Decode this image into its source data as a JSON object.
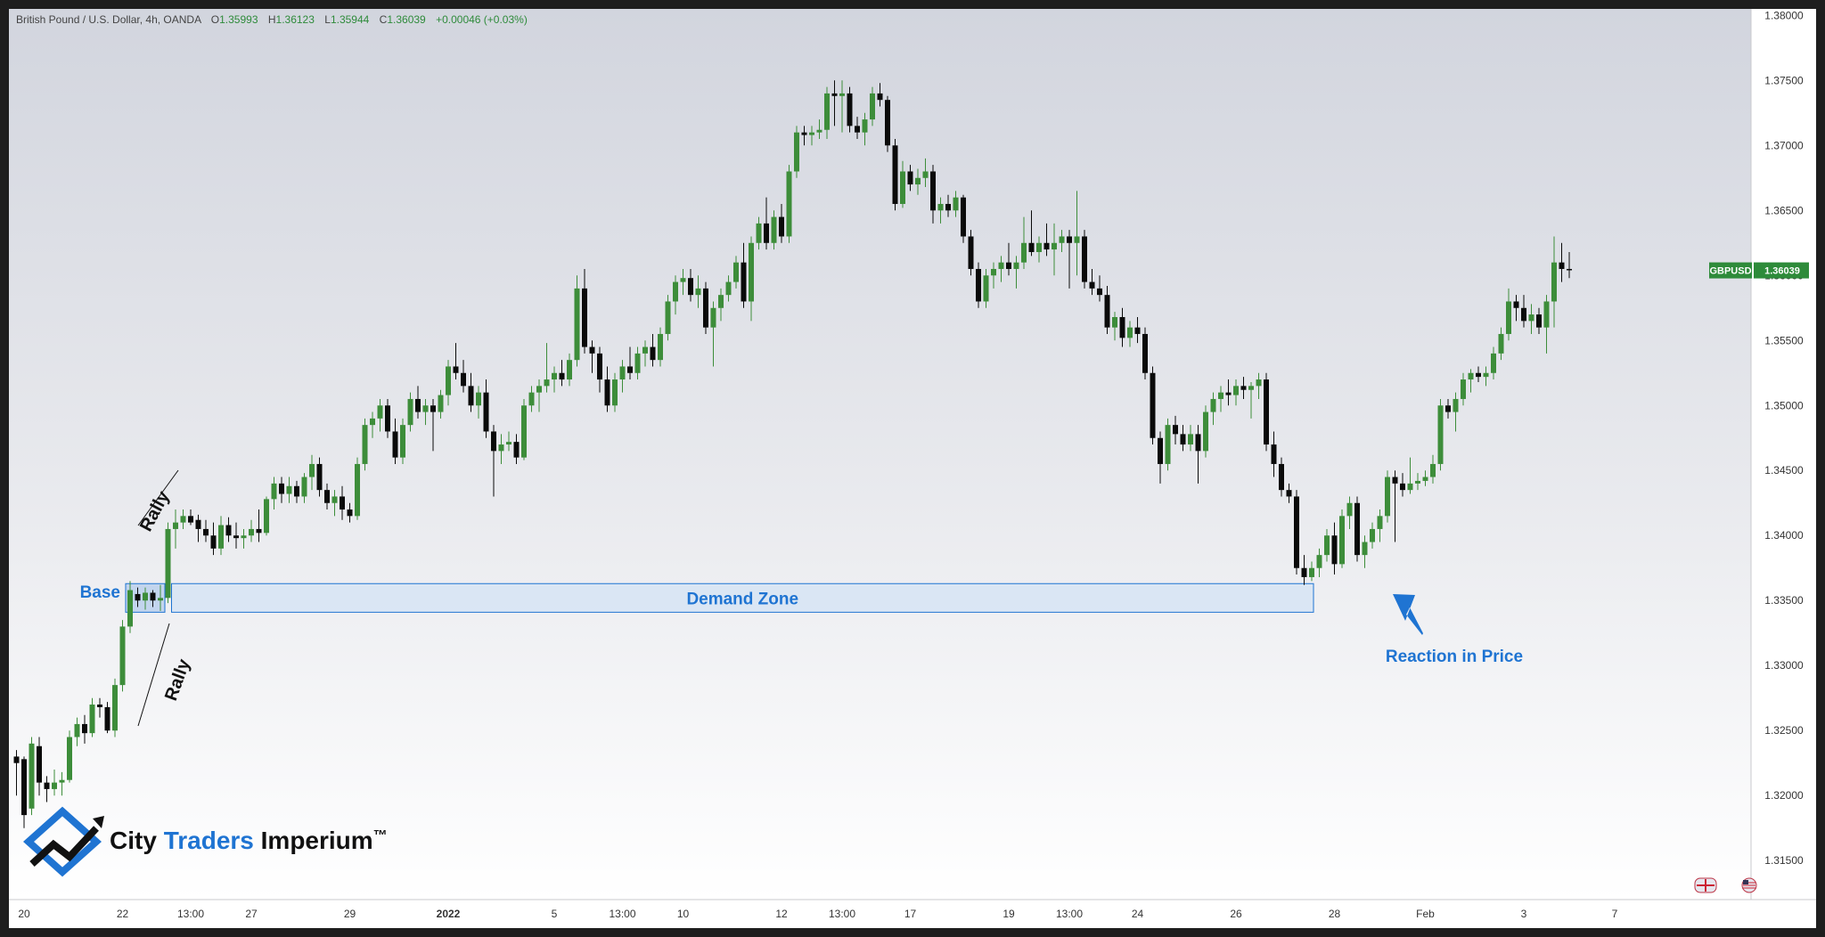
{
  "header": {
    "symbol_desc": "British Pound / U.S. Dollar, 4h, OANDA",
    "o_label": "O",
    "o_value": "1.35993",
    "h_label": "H",
    "h_value": "1.36123",
    "l_label": "L",
    "l_value": "1.35944",
    "c_label": "C",
    "c_value": "1.36039",
    "change": "+0.00046 (+0.03%)"
  },
  "price_tag": {
    "symbol": "GBPUSD",
    "value": "1.36039",
    "price": 1.36039
  },
  "annotations": {
    "base": "Base",
    "rally_up": "Rally",
    "rally_down": "Rally",
    "demand_zone": "Demand Zone",
    "reaction": "Reaction in Price"
  },
  "logo": {
    "word1": "City ",
    "word2": "Traders",
    "word3": " Imperium",
    "tm": "™"
  },
  "colors": {
    "up": "#3d8d3a",
    "down": "#0a0a0a",
    "accent": "#1f74d2",
    "zone_fill": "#d6e4f5",
    "tag_bg": "#2e8b3a"
  },
  "chart_data": {
    "type": "candlestick",
    "title": "British Pound / U.S. Dollar, 4h, OANDA",
    "ylim": [
      1.312,
      1.3805
    ],
    "y_ticks": [
      1.315,
      1.32,
      1.325,
      1.33,
      1.335,
      1.34,
      1.345,
      1.35,
      1.355,
      1.36,
      1.365,
      1.37,
      1.375,
      1.38
    ],
    "y_tick_labels": [
      "1.31500",
      "1.32000",
      "1.32500",
      "1.33000",
      "1.33500",
      "1.34000",
      "1.34500",
      "1.35000",
      "1.35500",
      "1.36000",
      "1.36500",
      "1.37000",
      "1.37500",
      "1.38000"
    ],
    "x_labels": [
      {
        "label": "20",
        "bar": 1,
        "bold": false
      },
      {
        "label": "22",
        "bar": 14,
        "bold": false
      },
      {
        "label": "13:00",
        "bar": 23,
        "bold": false
      },
      {
        "label": "27",
        "bar": 31,
        "bold": false
      },
      {
        "label": "29",
        "bar": 44,
        "bold": false
      },
      {
        "label": "2022",
        "bar": 57,
        "bold": true
      },
      {
        "label": "5",
        "bar": 71,
        "bold": false
      },
      {
        "label": "13:00",
        "bar": 80,
        "bold": false
      },
      {
        "label": "10",
        "bar": 88,
        "bold": false
      },
      {
        "label": "12",
        "bar": 101,
        "bold": false
      },
      {
        "label": "13:00",
        "bar": 109,
        "bold": false
      },
      {
        "label": "17",
        "bar": 118,
        "bold": false
      },
      {
        "label": "19",
        "bar": 131,
        "bold": false
      },
      {
        "label": "13:00",
        "bar": 139,
        "bold": false
      },
      {
        "label": "24",
        "bar": 148,
        "bold": false
      },
      {
        "label": "26",
        "bar": 161,
        "bold": false
      },
      {
        "label": "28",
        "bar": 174,
        "bold": false
      },
      {
        "label": "Feb",
        "bar": 186,
        "bold": false
      },
      {
        "label": "3",
        "bar": 199,
        "bold": false
      },
      {
        "label": "7",
        "bar": 211,
        "bold": false
      }
    ],
    "demand_zone": {
      "from_bar": 14,
      "to_bar": 171,
      "low": 1.3341,
      "high": 1.3363
    },
    "ohlc": [
      [
        1.323,
        1.3235,
        1.32,
        1.3225
      ],
      [
        1.3228,
        1.323,
        1.3175,
        1.3185
      ],
      [
        1.319,
        1.3245,
        1.3185,
        1.324
      ],
      [
        1.3238,
        1.3245,
        1.32,
        1.321
      ],
      [
        1.321,
        1.3215,
        1.3195,
        1.3205
      ],
      [
        1.3205,
        1.322,
        1.32,
        1.321
      ],
      [
        1.321,
        1.3218,
        1.32,
        1.3212
      ],
      [
        1.3212,
        1.325,
        1.321,
        1.3245
      ],
      [
        1.3245,
        1.326,
        1.3238,
        1.3255
      ],
      [
        1.3255,
        1.3262,
        1.324,
        1.3248
      ],
      [
        1.3248,
        1.3275,
        1.3245,
        1.327
      ],
      [
        1.327,
        1.3275,
        1.326,
        1.3268
      ],
      [
        1.3268,
        1.3272,
        1.3248,
        1.325
      ],
      [
        1.325,
        1.329,
        1.3245,
        1.3285
      ],
      [
        1.3285,
        1.3335,
        1.328,
        1.333
      ],
      [
        1.333,
        1.3365,
        1.3325,
        1.3358
      ],
      [
        1.3355,
        1.336,
        1.3345,
        1.335
      ],
      [
        1.335,
        1.336,
        1.3343,
        1.3356
      ],
      [
        1.3356,
        1.3358,
        1.3345,
        1.335
      ],
      [
        1.335,
        1.3362,
        1.3342,
        1.3352
      ],
      [
        1.3352,
        1.341,
        1.3348,
        1.3405
      ],
      [
        1.3405,
        1.342,
        1.339,
        1.341
      ],
      [
        1.341,
        1.342,
        1.3405,
        1.3415
      ],
      [
        1.3415,
        1.342,
        1.3408,
        1.341
      ],
      [
        1.3412,
        1.3416,
        1.3395,
        1.3405
      ],
      [
        1.3405,
        1.3412,
        1.3395,
        1.34
      ],
      [
        1.34,
        1.341,
        1.3385,
        1.339
      ],
      [
        1.339,
        1.3415,
        1.3385,
        1.3408
      ],
      [
        1.3408,
        1.3414,
        1.3395,
        1.34
      ],
      [
        1.34,
        1.341,
        1.339,
        1.3398
      ],
      [
        1.3398,
        1.3405,
        1.339,
        1.34
      ],
      [
        1.34,
        1.3412,
        1.3395,
        1.3405
      ],
      [
        1.3405,
        1.342,
        1.3395,
        1.3402
      ],
      [
        1.3402,
        1.343,
        1.34,
        1.3428
      ],
      [
        1.3428,
        1.3445,
        1.342,
        1.344
      ],
      [
        1.344,
        1.3445,
        1.3425,
        1.3432
      ],
      [
        1.3432,
        1.3445,
        1.3425,
        1.3438
      ],
      [
        1.3438,
        1.3442,
        1.3425,
        1.343
      ],
      [
        1.343,
        1.3448,
        1.3425,
        1.3445
      ],
      [
        1.3445,
        1.3462,
        1.3435,
        1.3455
      ],
      [
        1.3455,
        1.346,
        1.343,
        1.3435
      ],
      [
        1.3435,
        1.344,
        1.342,
        1.3425
      ],
      [
        1.3425,
        1.3435,
        1.3415,
        1.343
      ],
      [
        1.343,
        1.3438,
        1.3412,
        1.342
      ],
      [
        1.342,
        1.3425,
        1.341,
        1.3415
      ],
      [
        1.3415,
        1.346,
        1.3412,
        1.3455
      ],
      [
        1.3455,
        1.349,
        1.345,
        1.3485
      ],
      [
        1.3485,
        1.3495,
        1.3475,
        1.349
      ],
      [
        1.349,
        1.3505,
        1.348,
        1.35
      ],
      [
        1.35,
        1.3505,
        1.3475,
        1.348
      ],
      [
        1.348,
        1.349,
        1.3455,
        1.346
      ],
      [
        1.346,
        1.349,
        1.3455,
        1.3485
      ],
      [
        1.3485,
        1.351,
        1.348,
        1.3505
      ],
      [
        1.3505,
        1.3515,
        1.349,
        1.3495
      ],
      [
        1.3495,
        1.3505,
        1.3485,
        1.35
      ],
      [
        1.35,
        1.3505,
        1.3465,
        1.3495
      ],
      [
        1.3495,
        1.3512,
        1.349,
        1.3508
      ],
      [
        1.3508,
        1.3535,
        1.35,
        1.353
      ],
      [
        1.353,
        1.3548,
        1.352,
        1.3525
      ],
      [
        1.3525,
        1.3535,
        1.351,
        1.3515
      ],
      [
        1.3515,
        1.3525,
        1.3495,
        1.35
      ],
      [
        1.35,
        1.3515,
        1.349,
        1.351
      ],
      [
        1.351,
        1.352,
        1.3475,
        1.348
      ],
      [
        1.348,
        1.3485,
        1.343,
        1.3465
      ],
      [
        1.3465,
        1.3478,
        1.3455,
        1.347
      ],
      [
        1.347,
        1.348,
        1.3465,
        1.3472
      ],
      [
        1.3472,
        1.3478,
        1.3455,
        1.346
      ],
      [
        1.346,
        1.3505,
        1.3458,
        1.35
      ],
      [
        1.35,
        1.3515,
        1.3495,
        1.351
      ],
      [
        1.351,
        1.352,
        1.3495,
        1.3515
      ],
      [
        1.3515,
        1.3548,
        1.351,
        1.352
      ],
      [
        1.352,
        1.353,
        1.351,
        1.3525
      ],
      [
        1.3525,
        1.3535,
        1.3515,
        1.352
      ],
      [
        1.352,
        1.354,
        1.3515,
        1.3535
      ],
      [
        1.3535,
        1.36,
        1.353,
        1.359
      ],
      [
        1.359,
        1.3605,
        1.354,
        1.3545
      ],
      [
        1.3545,
        1.355,
        1.3525,
        1.354
      ],
      [
        1.354,
        1.3545,
        1.351,
        1.352
      ],
      [
        1.352,
        1.353,
        1.3495,
        1.35
      ],
      [
        1.35,
        1.3525,
        1.3495,
        1.352
      ],
      [
        1.352,
        1.3535,
        1.351,
        1.353
      ],
      [
        1.353,
        1.3545,
        1.352,
        1.3525
      ],
      [
        1.3525,
        1.3545,
        1.352,
        1.354
      ],
      [
        1.354,
        1.355,
        1.353,
        1.3545
      ],
      [
        1.3545,
        1.3555,
        1.353,
        1.3535
      ],
      [
        1.3535,
        1.356,
        1.353,
        1.3555
      ],
      [
        1.3555,
        1.3585,
        1.355,
        1.358
      ],
      [
        1.358,
        1.36,
        1.357,
        1.3595
      ],
      [
        1.3595,
        1.3605,
        1.3585,
        1.3598
      ],
      [
        1.3598,
        1.3605,
        1.358,
        1.3585
      ],
      [
        1.3585,
        1.36,
        1.3575,
        1.359
      ],
      [
        1.359,
        1.3595,
        1.3555,
        1.356
      ],
      [
        1.356,
        1.358,
        1.353,
        1.3575
      ],
      [
        1.3575,
        1.359,
        1.3565,
        1.3585
      ],
      [
        1.3585,
        1.36,
        1.358,
        1.3595
      ],
      [
        1.3595,
        1.3615,
        1.359,
        1.361
      ],
      [
        1.361,
        1.3625,
        1.3575,
        1.358
      ],
      [
        1.358,
        1.363,
        1.3565,
        1.3625
      ],
      [
        1.3625,
        1.3645,
        1.362,
        1.364
      ],
      [
        1.364,
        1.366,
        1.362,
        1.3625
      ],
      [
        1.3625,
        1.365,
        1.362,
        1.3645
      ],
      [
        1.3645,
        1.3655,
        1.3625,
        1.363
      ],
      [
        1.363,
        1.3685,
        1.3625,
        1.368
      ],
      [
        1.368,
        1.3715,
        1.3675,
        1.371
      ],
      [
        1.371,
        1.3715,
        1.37,
        1.3708
      ],
      [
        1.3708,
        1.3715,
        1.37,
        1.371
      ],
      [
        1.371,
        1.372,
        1.3705,
        1.3712
      ],
      [
        1.3712,
        1.3745,
        1.3705,
        1.374
      ],
      [
        1.374,
        1.375,
        1.3715,
        1.3738
      ],
      [
        1.3738,
        1.375,
        1.371,
        1.374
      ],
      [
        1.374,
        1.3745,
        1.371,
        1.3715
      ],
      [
        1.3715,
        1.3722,
        1.3705,
        1.371
      ],
      [
        1.371,
        1.3725,
        1.37,
        1.372
      ],
      [
        1.372,
        1.3745,
        1.3715,
        1.374
      ],
      [
        1.374,
        1.3748,
        1.373,
        1.3735
      ],
      [
        1.3735,
        1.3738,
        1.3695,
        1.37
      ],
      [
        1.37,
        1.3705,
        1.365,
        1.3655
      ],
      [
        1.3655,
        1.3688,
        1.3652,
        1.368
      ],
      [
        1.368,
        1.3685,
        1.3665,
        1.367
      ],
      [
        1.367,
        1.3682,
        1.3662,
        1.3675
      ],
      [
        1.3675,
        1.369,
        1.3668,
        1.368
      ],
      [
        1.368,
        1.3685,
        1.364,
        1.365
      ],
      [
        1.365,
        1.366,
        1.364,
        1.3655
      ],
      [
        1.3655,
        1.3662,
        1.3645,
        1.365
      ],
      [
        1.365,
        1.3665,
        1.3645,
        1.366
      ],
      [
        1.366,
        1.3662,
        1.3625,
        1.363
      ],
      [
        1.363,
        1.3635,
        1.36,
        1.3605
      ],
      [
        1.3605,
        1.361,
        1.3575,
        1.358
      ],
      [
        1.358,
        1.3605,
        1.3575,
        1.36
      ],
      [
        1.36,
        1.361,
        1.359,
        1.3605
      ],
      [
        1.3605,
        1.3615,
        1.3595,
        1.361
      ],
      [
        1.361,
        1.3625,
        1.36,
        1.3605
      ],
      [
        1.3605,
        1.3615,
        1.359,
        1.361
      ],
      [
        1.361,
        1.3645,
        1.3605,
        1.3625
      ],
      [
        1.3625,
        1.365,
        1.3615,
        1.3618
      ],
      [
        1.3618,
        1.363,
        1.361,
        1.3625
      ],
      [
        1.3625,
        1.364,
        1.3615,
        1.362
      ],
      [
        1.362,
        1.364,
        1.36,
        1.3625
      ],
      [
        1.3625,
        1.3635,
        1.3618,
        1.363
      ],
      [
        1.363,
        1.3635,
        1.359,
        1.3625
      ],
      [
        1.3625,
        1.3665,
        1.36,
        1.363
      ],
      [
        1.363,
        1.3635,
        1.359,
        1.3595
      ],
      [
        1.3595,
        1.3605,
        1.3585,
        1.359
      ],
      [
        1.359,
        1.36,
        1.358,
        1.3585
      ],
      [
        1.3585,
        1.3592,
        1.3555,
        1.356
      ],
      [
        1.356,
        1.3572,
        1.355,
        1.3568
      ],
      [
        1.3568,
        1.3575,
        1.3545,
        1.3552
      ],
      [
        1.3552,
        1.3565,
        1.3545,
        1.356
      ],
      [
        1.356,
        1.3568,
        1.3548,
        1.3555
      ],
      [
        1.3555,
        1.356,
        1.352,
        1.3525
      ],
      [
        1.3525,
        1.353,
        1.347,
        1.3475
      ],
      [
        1.3475,
        1.348,
        1.344,
        1.3455
      ],
      [
        1.3455,
        1.349,
        1.345,
        1.3485
      ],
      [
        1.3485,
        1.3492,
        1.347,
        1.3478
      ],
      [
        1.3478,
        1.3485,
        1.3465,
        1.347
      ],
      [
        1.347,
        1.3485,
        1.3465,
        1.3478
      ],
      [
        1.3478,
        1.3485,
        1.344,
        1.3465
      ],
      [
        1.3465,
        1.35,
        1.346,
        1.3495
      ],
      [
        1.3495,
        1.351,
        1.3485,
        1.3505
      ],
      [
        1.3505,
        1.3515,
        1.3495,
        1.351
      ],
      [
        1.351,
        1.352,
        1.35,
        1.3508
      ],
      [
        1.3508,
        1.352,
        1.35,
        1.3515
      ],
      [
        1.3515,
        1.3522,
        1.3505,
        1.3512
      ],
      [
        1.3512,
        1.3518,
        1.349,
        1.3515
      ],
      [
        1.3515,
        1.3525,
        1.3505,
        1.352
      ],
      [
        1.352,
        1.3525,
        1.3465,
        1.347
      ],
      [
        1.347,
        1.348,
        1.3445,
        1.3455
      ],
      [
        1.3455,
        1.346,
        1.343,
        1.3435
      ],
      [
        1.3435,
        1.344,
        1.3425,
        1.343
      ],
      [
        1.343,
        1.3435,
        1.337,
        1.3375
      ],
      [
        1.3375,
        1.3385,
        1.3362,
        1.3368
      ],
      [
        1.3368,
        1.338,
        1.3365,
        1.3375
      ],
      [
        1.3375,
        1.339,
        1.3368,
        1.3385
      ],
      [
        1.3385,
        1.3405,
        1.338,
        1.34
      ],
      [
        1.34,
        1.341,
        1.337,
        1.3378
      ],
      [
        1.3378,
        1.342,
        1.3375,
        1.3415
      ],
      [
        1.3415,
        1.343,
        1.3405,
        1.3425
      ],
      [
        1.3425,
        1.343,
        1.338,
        1.3385
      ],
      [
        1.3385,
        1.34,
        1.3375,
        1.3395
      ],
      [
        1.3395,
        1.341,
        1.339,
        1.3405
      ],
      [
        1.3405,
        1.342,
        1.3395,
        1.3415
      ],
      [
        1.3415,
        1.345,
        1.341,
        1.3445
      ],
      [
        1.3445,
        1.345,
        1.3395,
        1.344
      ],
      [
        1.344,
        1.3448,
        1.343,
        1.3435
      ],
      [
        1.3435,
        1.346,
        1.3432,
        1.344
      ],
      [
        1.344,
        1.3448,
        1.3435,
        1.3442
      ],
      [
        1.3442,
        1.345,
        1.3438,
        1.3445
      ],
      [
        1.3445,
        1.3462,
        1.344,
        1.3455
      ],
      [
        1.3455,
        1.3505,
        1.345,
        1.35
      ],
      [
        1.35,
        1.3505,
        1.349,
        1.3495
      ],
      [
        1.3495,
        1.351,
        1.348,
        1.3505
      ],
      [
        1.3505,
        1.3525,
        1.35,
        1.352
      ],
      [
        1.352,
        1.3528,
        1.351,
        1.3525
      ],
      [
        1.3525,
        1.353,
        1.3518,
        1.3522
      ],
      [
        1.3522,
        1.353,
        1.3515,
        1.3525
      ],
      [
        1.3525,
        1.3545,
        1.352,
        1.354
      ],
      [
        1.354,
        1.356,
        1.3535,
        1.3555
      ],
      [
        1.3555,
        1.359,
        1.355,
        1.358
      ],
      [
        1.358,
        1.3585,
        1.3565,
        1.3575
      ],
      [
        1.3575,
        1.3585,
        1.356,
        1.3565
      ],
      [
        1.3565,
        1.3578,
        1.3555,
        1.357
      ],
      [
        1.357,
        1.3575,
        1.3555,
        1.356
      ],
      [
        1.356,
        1.3585,
        1.354,
        1.358
      ],
      [
        1.358,
        1.363,
        1.356,
        1.361
      ],
      [
        1.361,
        1.3625,
        1.3595,
        1.3605
      ],
      [
        1.3605,
        1.3618,
        1.3598,
        1.3604
      ]
    ]
  }
}
